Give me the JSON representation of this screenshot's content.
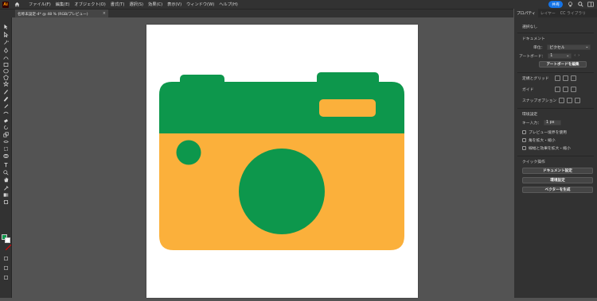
{
  "app": {
    "logo_text": "Ai"
  },
  "menubar": {
    "items": [
      "ファイル(F)",
      "編集(E)",
      "オブジェクト(O)",
      "書式(T)",
      "選択(S)",
      "効果(C)",
      "表示(V)",
      "ウィンドウ(W)",
      "ヘルプ(H)"
    ],
    "share_label": "共有"
  },
  "document_tab": {
    "title": "名称未設定-4* @ 48 % (RGB/プレビュー)",
    "close": "×"
  },
  "panel": {
    "tabs": [
      "プロパティ",
      "レイヤー",
      "CC ライブラリ"
    ],
    "selection": "選択なし",
    "document_heading": "ドキュメント",
    "unit_label": "単位：",
    "unit_value": "ピクセル",
    "artboard_label": "アートボード：",
    "artboard_value": "1",
    "edit_artboard_button": "アートボードを編集",
    "rulers_grids": "定規とグリッド",
    "guides": "ガイド",
    "snap_options": "スナップオプション",
    "preferences_heading": "環境設定",
    "key_increment_label": "キー入力：",
    "key_increment_value": "1 px",
    "checks": [
      "プレビュー境界を使用",
      "角を拡大・縮小",
      "線幅と効果を拡大・縮小"
    ],
    "quick_actions_heading": "クイック操作",
    "quick_buttons": [
      "ドキュメント設定",
      "環境設定",
      "ベクターを生成"
    ]
  },
  "colors": {
    "camera_green": "#0d974c",
    "camera_orange": "#fbb03b",
    "share_blue": "#1473e6",
    "fill_swatch": "#0d974c"
  },
  "tool_icons": [
    "selection-tool-icon",
    "direct-selection-tool-icon",
    "magic-wand-icon",
    "pen-tool-icon",
    "curvature-tool-icon",
    "rectangle-tool-icon",
    "ellipse-tool-icon",
    "polygon-tool-icon",
    "star-tool-icon",
    "paintbrush-icon",
    "blob-brush-icon",
    "pencil-icon",
    "shaper-icon",
    "eraser-icon",
    "rotate-tool-icon",
    "scale-tool-icon",
    "width-tool-icon",
    "free-transform-icon",
    "shape-builder-icon",
    "type-tool-icon",
    "zoom-tool-icon",
    "hand-tool-icon",
    "eyedropper-icon",
    "gradient-tool-icon",
    "artboard-tool-icon"
  ]
}
